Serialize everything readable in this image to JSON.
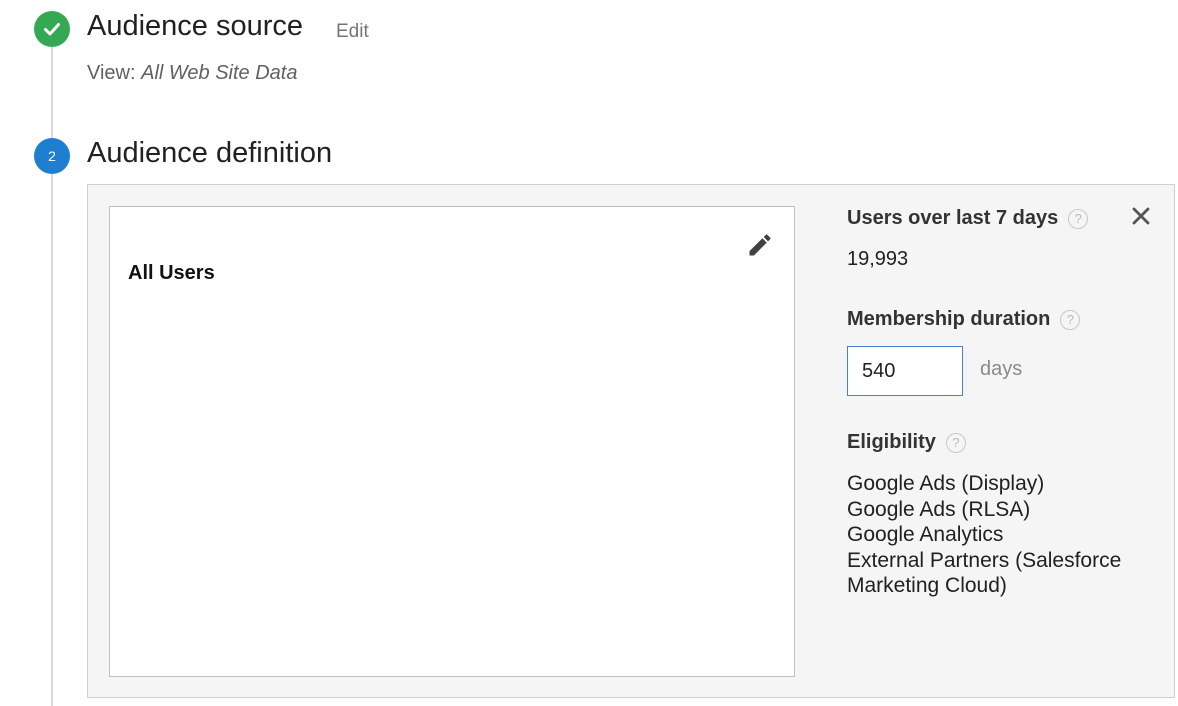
{
  "step1": {
    "title": "Audience source",
    "edit_label": "Edit",
    "view_prefix": "View: ",
    "view_name": "All Web Site Data",
    "status_icon": "check-icon",
    "status_color": "#34a853"
  },
  "step2": {
    "number": "2",
    "title": "Audience definition",
    "status_color": "#1e7fd0"
  },
  "definition": {
    "segment_name": "All Users",
    "edit_icon": "pencil-icon",
    "users": {
      "label": "Users over last 7 days",
      "value": "19,993",
      "help_icon": "help-icon"
    },
    "close_icon": "close-icon",
    "membership": {
      "label": "Membership duration",
      "value": "540",
      "unit": "days",
      "help_icon": "help-icon"
    },
    "eligibility": {
      "label": "Eligibility",
      "help_icon": "help-icon",
      "items": [
        "Google Ads (Display)",
        "Google Ads (RLSA)",
        "Google Analytics",
        "External Partners (Salesforce Marketing Cloud)"
      ]
    }
  }
}
